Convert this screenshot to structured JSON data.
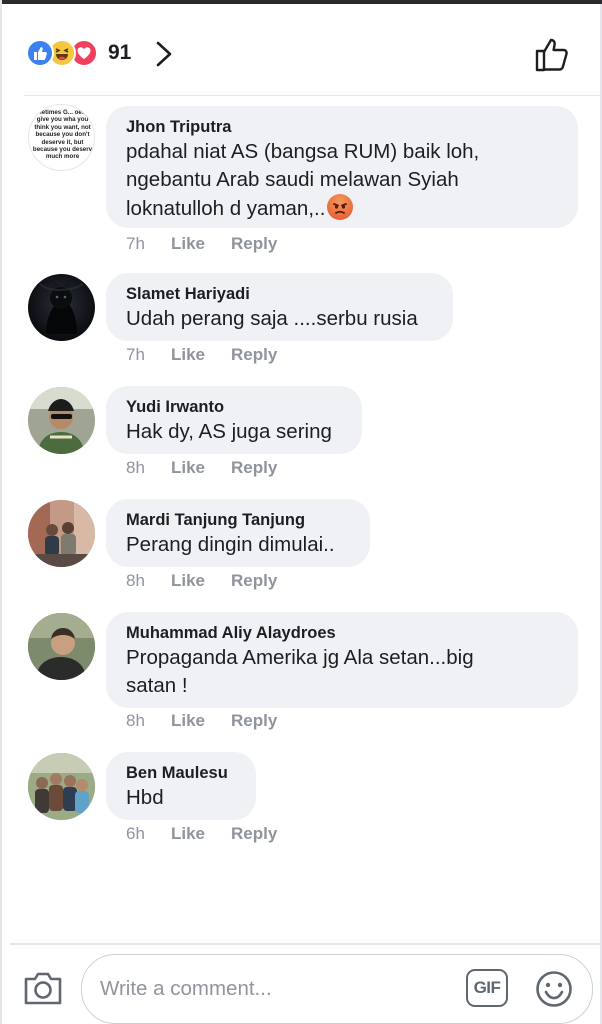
{
  "header": {
    "reaction_count": "91",
    "reactions": [
      "like-icon",
      "haha-icon",
      "love-icon"
    ]
  },
  "comments": [
    {
      "author": "Jhon Triputra",
      "text": "pdahal niat AS (bangsa RUM) baik loh, ngebantu Arab saudi melawan Syiah loknatulloh d yaman,..",
      "emoji": "angry-emoji",
      "time": "7h",
      "like": "Like",
      "reply": "Reply",
      "avatar_text": "ometimes G... oesn't give you wha you think you want, not because you don't deserve it, but because you deserv much more"
    },
    {
      "author": "Slamet Hariyadi",
      "text": "Udah perang saja ....serbu rusia",
      "time": "7h",
      "like": "Like",
      "reply": "Reply"
    },
    {
      "author": "Yudi Irwanto",
      "text": "Hak dy, AS juga sering",
      "time": "8h",
      "like": "Like",
      "reply": "Reply"
    },
    {
      "author": "Mardi Tanjung Tanjung",
      "text": "Perang dingin dimulai..",
      "time": "8h",
      "like": "Like",
      "reply": "Reply"
    },
    {
      "author": "Muhammad Aliy Alaydroes",
      "text": "Propaganda Amerika jg Ala setan...big satan !",
      "time": "8h",
      "like": "Like",
      "reply": "Reply"
    },
    {
      "author": "Ben Maulesu",
      "text": "Hbd",
      "time": "6h",
      "like": "Like",
      "reply": "Reply"
    }
  ],
  "composer": {
    "placeholder": "Write a comment...",
    "gif_label": "GIF"
  },
  "colors": {
    "accent_blue": "#3b82f0",
    "love_red": "#f0405b",
    "haha_yellow": "#f6c640",
    "bubble_bg": "#f0f1f4",
    "meta_gray": "#90949c"
  }
}
